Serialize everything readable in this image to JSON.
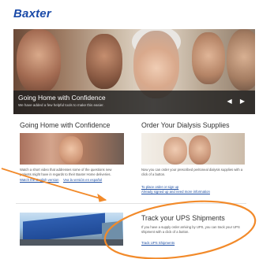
{
  "brand": {
    "logo_text": "Baxter",
    "logo_color": "#1a4aa8"
  },
  "hero": {
    "title": "Going Home with Confidence",
    "subtitle": "We have added a few helpful tools to make this easier.",
    "arrows": "◀ ▶"
  },
  "columns": [
    {
      "title": "Going Home with Confidence",
      "text": "Watch a short video that addresses some of the questions new patients might have in regards to their Baxter Home deliveries.",
      "links": [
        "Watch the English version",
        "Vea la versión en español"
      ]
    },
    {
      "title": "Order Your Dialysis Supplies",
      "text": "Now you can order your prescribed peritoneal dialysis supplies with a click of a button.",
      "links": [
        "To place order or sign up",
        "Already signed up and need more information"
      ]
    }
  ],
  "ups": {
    "title": "Track your UPS Shipments",
    "text": "If you have a supply order arriving by UPS, you can track your UPS shipment with a click of a button.",
    "link": "Track UPS Shipments"
  },
  "colors": {
    "link": "#1f4fa3",
    "annotation": "#f28a2a"
  }
}
